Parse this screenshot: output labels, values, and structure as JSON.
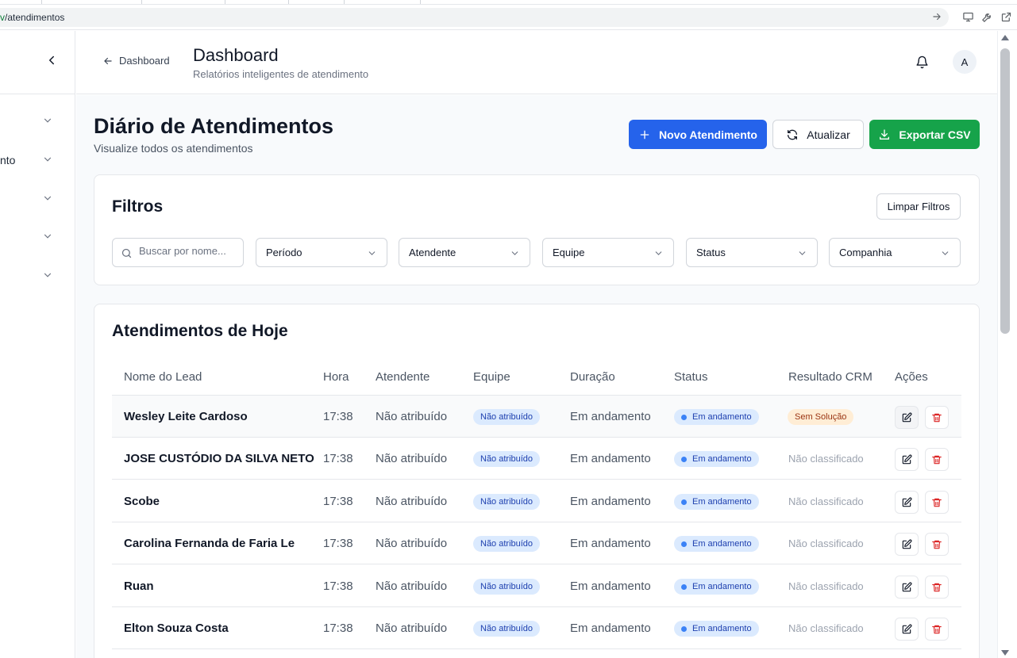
{
  "browser": {
    "url_prefix": "v",
    "url_path": "/atendimentos"
  },
  "sidebar": {
    "items": [
      {
        "label": ""
      },
      {
        "label": "nto"
      },
      {
        "label": ""
      },
      {
        "label": ""
      },
      {
        "label": ""
      }
    ]
  },
  "header": {
    "back_label": "Dashboard",
    "title": "Dashboard",
    "subtitle": "Relatórios inteligentes de atendimento",
    "avatar_initial": "A"
  },
  "page": {
    "title": "Diário de Atendimentos",
    "subtitle": "Visualize todos os atendimentos",
    "new_button": "Novo Atendimento",
    "refresh_button": "Atualizar",
    "export_button": "Exportar CSV"
  },
  "filters": {
    "title": "Filtros",
    "clear_button": "Limpar Filtros",
    "search_placeholder": "Buscar por nome...",
    "selects": [
      "Período",
      "Atendente",
      "Equipe",
      "Status",
      "Companhia"
    ]
  },
  "table": {
    "title": "Atendimentos de Hoje",
    "columns": [
      "Nome do Lead",
      "Hora",
      "Atendente",
      "Equipe",
      "Duração",
      "Status",
      "Resultado CRM",
      "Ações"
    ],
    "rows": [
      {
        "name": "Wesley Leite Cardoso",
        "time": "17:38",
        "agent": "Não atribuído",
        "team": "Não atribuído",
        "duration": "Em andamento",
        "status": "Em andamento",
        "crm": "Sem Solução"
      },
      {
        "name": "JOSE CUSTÓDIO DA SILVA NETO",
        "time": "17:38",
        "agent": "Não atribuído",
        "team": "Não atribuído",
        "duration": "Em andamento",
        "status": "Em andamento",
        "crm": "Não classificado"
      },
      {
        "name": "Scobe",
        "time": "17:38",
        "agent": "Não atribuído",
        "team": "Não atribuído",
        "duration": "Em andamento",
        "status": "Em andamento",
        "crm": "Não classificado"
      },
      {
        "name": "Carolina Fernanda de Faria Le",
        "time": "17:38",
        "agent": "Não atribuído",
        "team": "Não atribuído",
        "duration": "Em andamento",
        "status": "Em andamento",
        "crm": "Não classificado"
      },
      {
        "name": "Ruan",
        "time": "17:38",
        "agent": "Não atribuído",
        "team": "Não atribuído",
        "duration": "Em andamento",
        "status": "Em andamento",
        "crm": "Não classificado"
      },
      {
        "name": "Elton Souza Costa",
        "time": "17:38",
        "agent": "Não atribuído",
        "team": "Não atribuído",
        "duration": "Em andamento",
        "status": "Em andamento",
        "crm": "Não classificado"
      }
    ]
  },
  "icons": {
    "collapse": "chevron-left-icon",
    "back": "arrow-left-icon",
    "notifications": "bell-icon",
    "new": "plus-icon",
    "refresh": "refresh-icon",
    "export": "download-icon",
    "search": "search-icon",
    "select": "chevron-down-icon",
    "edit": "edit-icon",
    "delete": "trash-icon"
  },
  "colors": {
    "primary": "#2563eb",
    "success": "#16a34a",
    "danger": "#dc2626",
    "badge_blue_bg": "#dbeafe",
    "badge_orange_bg": "#ffedd5"
  }
}
